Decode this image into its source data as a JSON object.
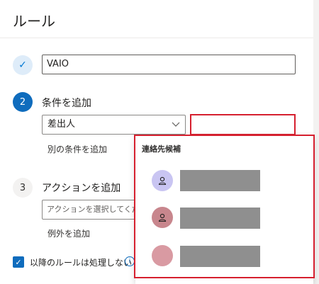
{
  "page": {
    "title": "ルール"
  },
  "step1": {
    "icon": "check-icon",
    "value": "VAIO"
  },
  "step2": {
    "number": "2",
    "label": "条件を追加",
    "condition": "差出人",
    "add_condition": "別の条件を追加"
  },
  "step3": {
    "number": "3",
    "label": "アクションを追加",
    "action_placeholder": "アクションを選択してください",
    "add_exception": "例外を追加"
  },
  "footer": {
    "checkbox_label": "以降のルールは処理しない",
    "checked": true
  },
  "dropdown": {
    "title": "連絡先候補",
    "contacts": [
      {
        "icon": "person-icon",
        "color": "#c9c5f2",
        "name": ""
      },
      {
        "icon": "person-icon",
        "color": "#c8868d",
        "name": ""
      },
      {
        "icon": "",
        "color": "#d99aa2",
        "name": ""
      }
    ]
  },
  "colors": {
    "accent": "#0f6cbd",
    "highlight": "#d6202f"
  }
}
